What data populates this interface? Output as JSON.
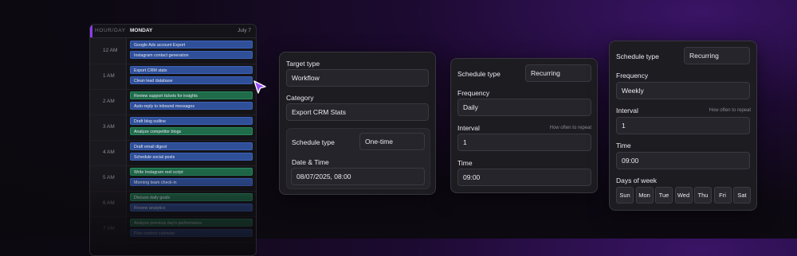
{
  "calendar": {
    "hourday_label": "HOUR/DAY",
    "day_label": "MONDAY",
    "date_label": "July 7",
    "hours": [
      "12 AM",
      "1 AM",
      "2 AM",
      "3 AM",
      "4 AM",
      "5 AM",
      "6 AM",
      "7 AM"
    ],
    "events": [
      {
        "label": "Google Ads account Export",
        "color": "blue"
      },
      {
        "label": "Instagram contact generation",
        "color": "blue"
      },
      {
        "label": "Export CRM stats",
        "color": "blue"
      },
      {
        "label": "Clean lead database",
        "color": "blue"
      },
      {
        "label": "Review support tickets for insights",
        "color": "green"
      },
      {
        "label": "Auto-reply to inbound messages",
        "color": "blue"
      },
      {
        "label": "Draft blog outline",
        "color": "blue"
      },
      {
        "label": "Analyze competitor blogs",
        "color": "green"
      },
      {
        "label": "Draft email digest",
        "color": "blue"
      },
      {
        "label": "Schedule social posts",
        "color": "blue"
      },
      {
        "label": "Write Instagram reel script",
        "color": "green"
      },
      {
        "label": "Morning team check-in",
        "color": "blue"
      },
      {
        "label": "Discuss daily goals",
        "color": "green"
      },
      {
        "label": "Review analytics",
        "color": "blue"
      },
      {
        "label": "Analyze previous day's performance",
        "color": "green"
      },
      {
        "label": "Plan content calendar",
        "color": "blue"
      }
    ]
  },
  "panel_one_time": {
    "target_type_label": "Target type",
    "target_type_value": "Workflow",
    "category_label": "Category",
    "category_value": "Export CRM Stats",
    "schedule_type_label": "Schedule type",
    "schedule_type_value": "One-time",
    "datetime_label": "Date & Time",
    "datetime_value": "08/07/2025, 08:00"
  },
  "panel_recurring_daily": {
    "schedule_type_label": "Schedule type",
    "schedule_type_value": "Recurring",
    "frequency_label": "Frequency",
    "frequency_value": "Daily",
    "interval_label": "Interval",
    "interval_hint": "How often to repeat",
    "interval_value": "1",
    "time_label": "Time",
    "time_value": "09:00"
  },
  "panel_recurring_weekly": {
    "schedule_type_label": "Schedule type",
    "schedule_type_value": "Recurring",
    "frequency_label": "Frequency",
    "frequency_value": "Weekly",
    "interval_label": "Interval",
    "interval_hint": "How often to repeat",
    "interval_value": "1",
    "time_label": "Time",
    "time_value": "09:00",
    "days_label": "Days of week",
    "days": [
      "Sun",
      "Mon",
      "Tue",
      "Wed",
      "Thu",
      "Fri",
      "Sat"
    ]
  },
  "colors": {
    "accent": "#8b3df0",
    "event_blue": "#2f4f98",
    "event_green": "#1f6b4a",
    "panel_bg": "#1d1c21",
    "field_bg": "#26252b"
  }
}
